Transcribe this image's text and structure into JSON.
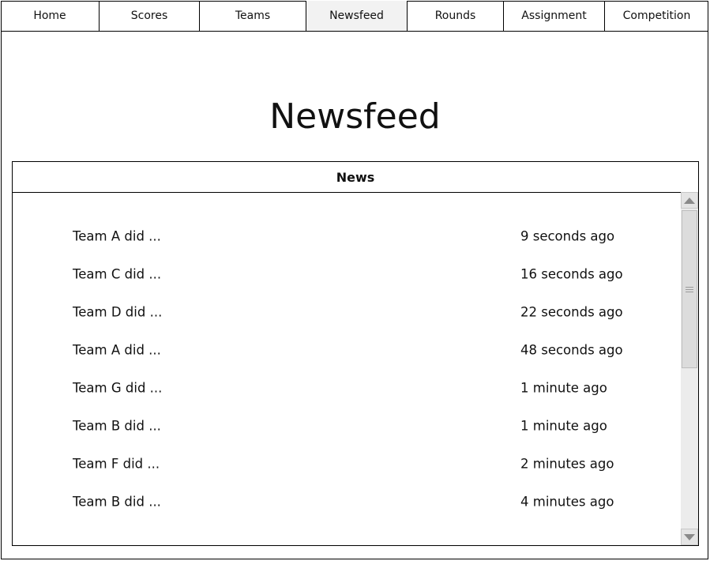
{
  "nav": {
    "items": [
      {
        "label": "Home",
        "active": false
      },
      {
        "label": "Scores",
        "active": false
      },
      {
        "label": "Teams",
        "active": false
      },
      {
        "label": "Newsfeed",
        "active": true
      },
      {
        "label": "Rounds",
        "active": false
      },
      {
        "label": "Assignment",
        "active": false
      },
      {
        "label": "Competition",
        "active": false
      }
    ]
  },
  "page": {
    "title": "Newsfeed"
  },
  "news": {
    "header": "News",
    "rows": [
      {
        "text": "Team A did ...",
        "time": "9 seconds ago"
      },
      {
        "text": "Team C did ...",
        "time": "16 seconds ago"
      },
      {
        "text": "Team D did ...",
        "time": "22 seconds ago"
      },
      {
        "text": "Team A did ...",
        "time": "48 seconds ago"
      },
      {
        "text": "Team G did ...",
        "time": "1 minute ago"
      },
      {
        "text": "Team B did ...",
        "time": "1 minute ago"
      },
      {
        "text": "Team F did ...",
        "time": "2 minutes ago"
      },
      {
        "text": "Team B did ...",
        "time": "4 minutes ago"
      }
    ]
  },
  "icons": {
    "scroll_up": "scroll-up-arrow-icon",
    "scroll_down": "scroll-down-arrow-icon",
    "thumb_grip": "grip-lines-icon"
  },
  "colors": {
    "active_tab_bg": "#f2f2f2",
    "scrollbar_track": "#ececec",
    "border": "#000000"
  }
}
